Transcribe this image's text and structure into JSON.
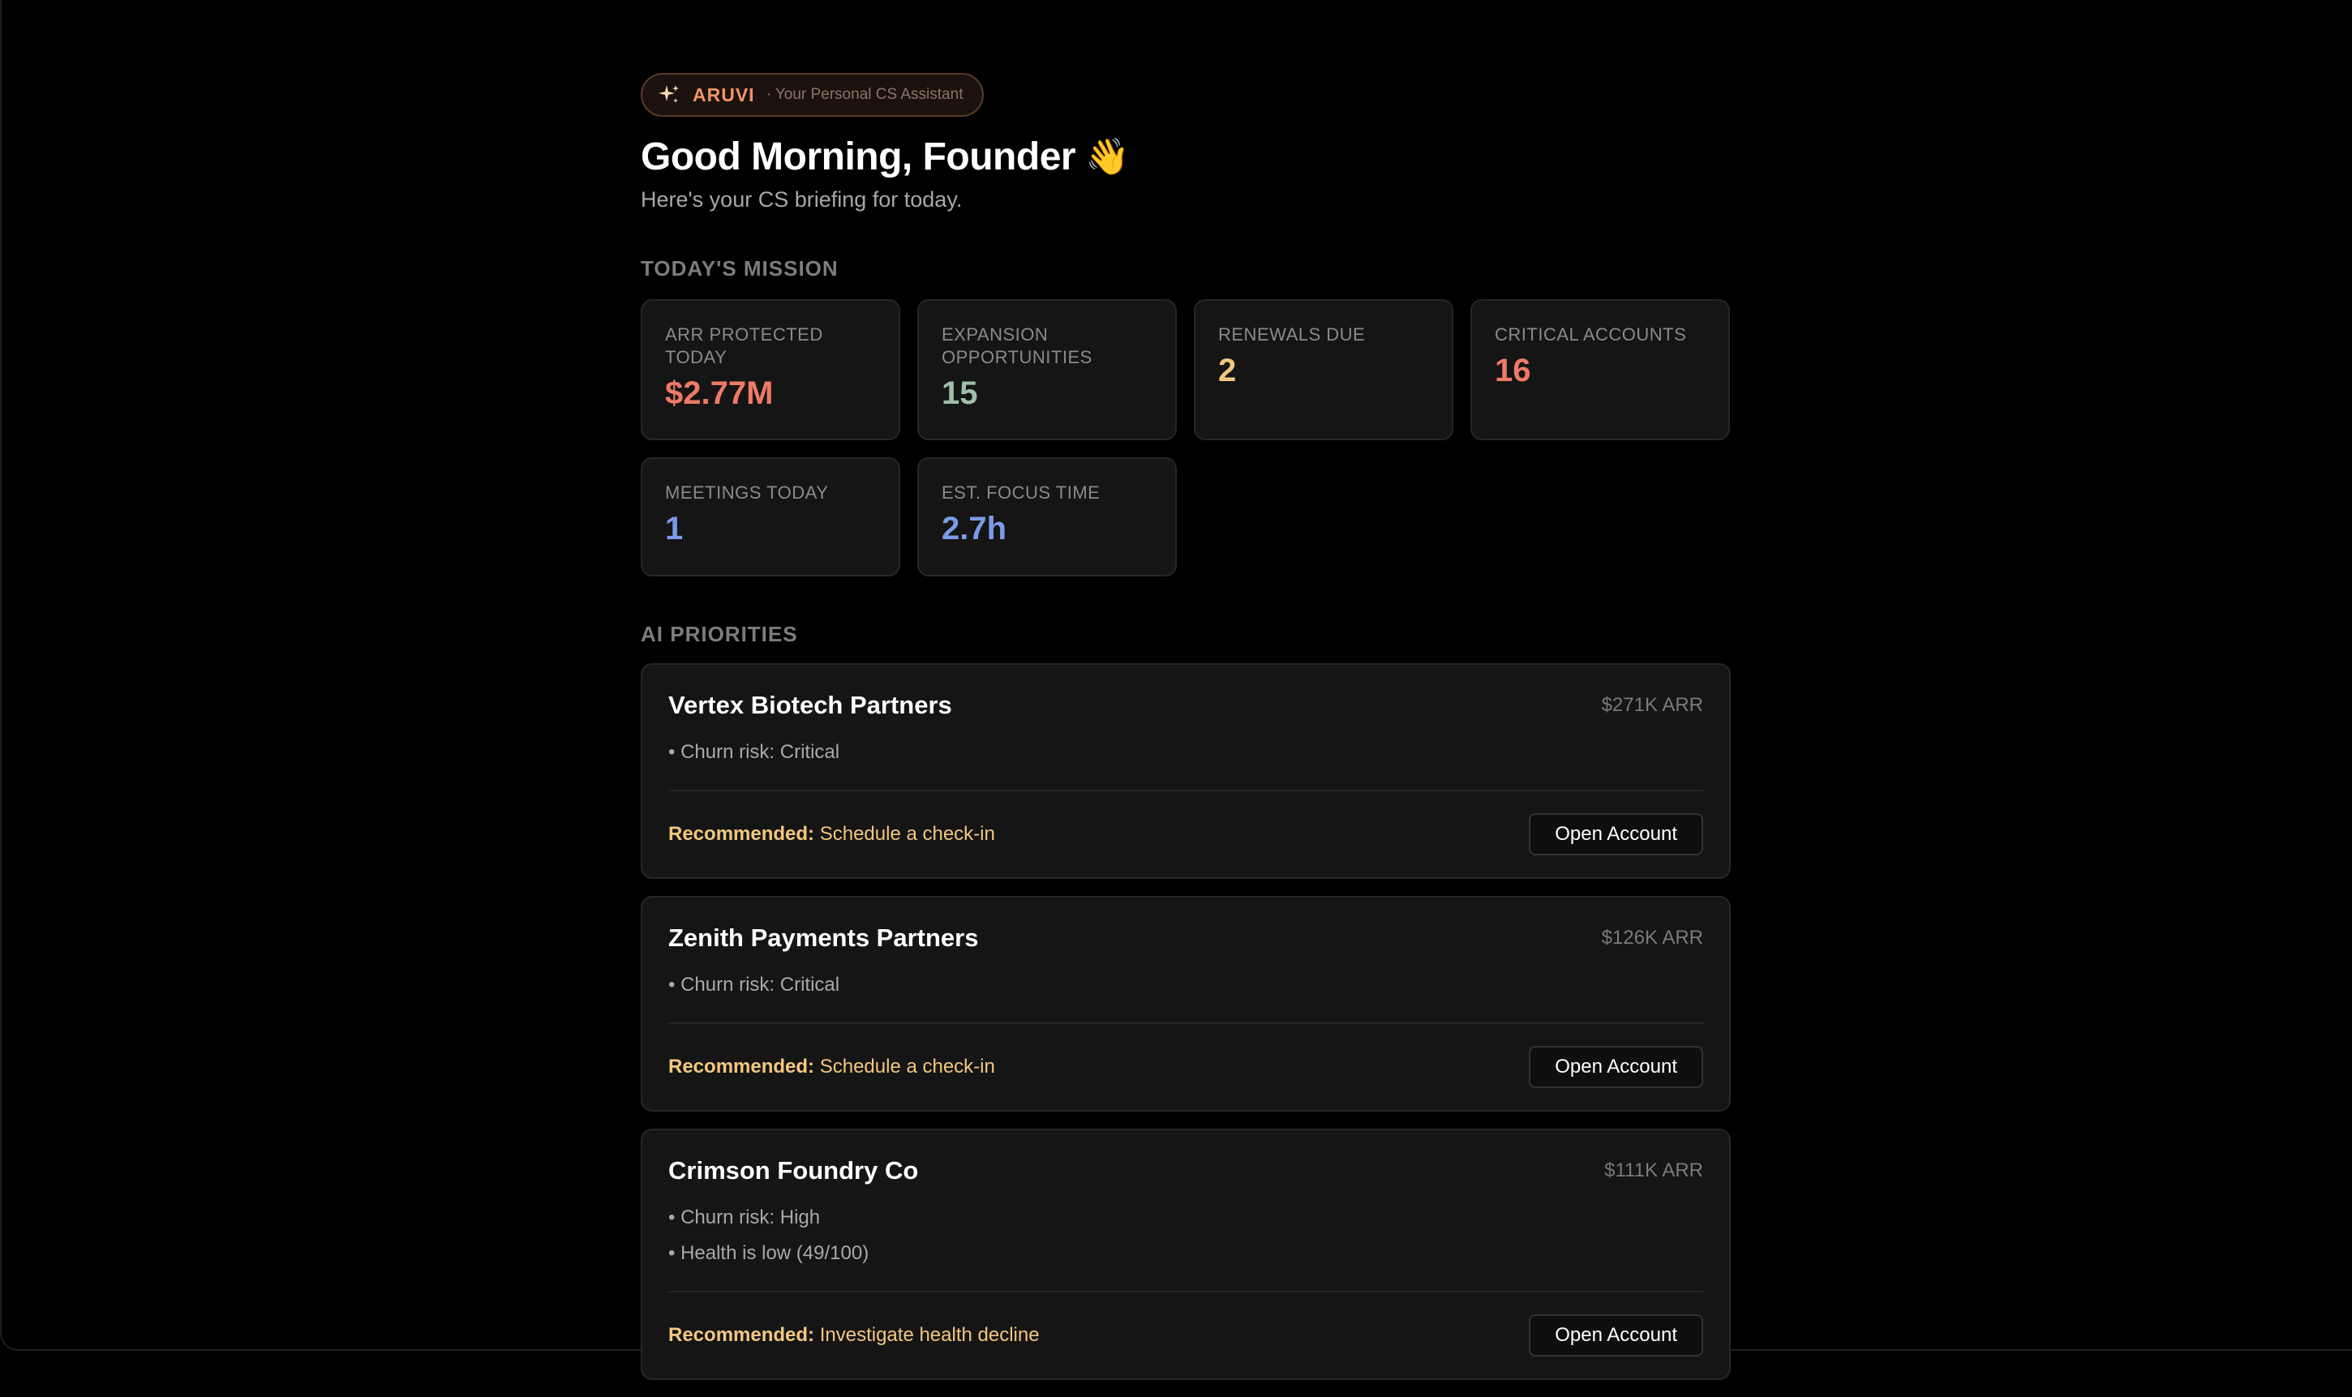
{
  "badge": {
    "icon": "sparkles-icon",
    "brand": "ARUVI",
    "tagline": "· Your Personal CS Assistant"
  },
  "header": {
    "greeting": "Good Morning, Founder",
    "wave": "👋",
    "subtitle": "Here's your CS briefing for today."
  },
  "mission": {
    "title": "TODAY'S MISSION",
    "metrics": [
      {
        "label": "ARR PROTECTED TODAY",
        "value": "$2.77M",
        "color": "#ef7a66"
      },
      {
        "label": "EXPANSION OPPORTUNITIES",
        "value": "15",
        "color": "#9fbfa8"
      },
      {
        "label": "RENEWALS DUE",
        "value": "2",
        "color": "#f2c77f"
      },
      {
        "label": "CRITICAL ACCOUNTS",
        "value": "16",
        "color": "#ef7a66"
      },
      {
        "label": "MEETINGS TODAY",
        "value": "1",
        "color": "#7b9be8"
      },
      {
        "label": "EST. FOCUS TIME",
        "value": "2.7h",
        "color": "#7b9be8"
      }
    ]
  },
  "priorities": {
    "title": "AI PRIORITIES",
    "items": [
      {
        "name": "Vertex Biotech Partners",
        "arr": "$271K ARR",
        "reasons": [
          "• Churn risk: Critical"
        ],
        "rec_label": "Recommended:",
        "rec_text": "Schedule a check-in",
        "button": "Open Account"
      },
      {
        "name": "Zenith Payments Partners",
        "arr": "$126K ARR",
        "reasons": [
          "• Churn risk: Critical"
        ],
        "rec_label": "Recommended:",
        "rec_text": "Schedule a check-in",
        "button": "Open Account"
      },
      {
        "name": "Crimson Foundry Co",
        "arr": "$111K ARR",
        "reasons": [
          "• Churn risk: High",
          "• Health is low (49/100)"
        ],
        "rec_label": "Recommended:",
        "rec_text": "Investigate health decline",
        "button": "Open Account"
      }
    ]
  }
}
